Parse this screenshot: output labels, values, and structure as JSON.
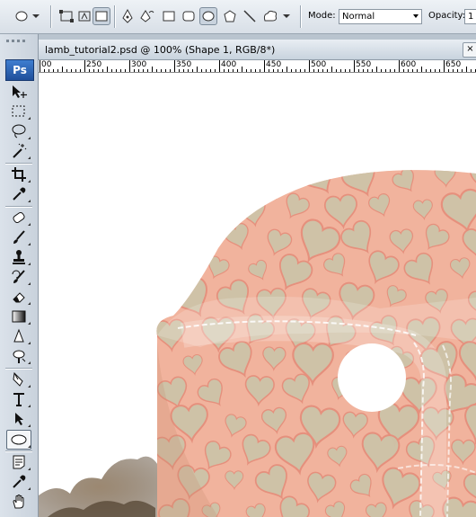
{
  "options": {
    "mode_label": "Mode:",
    "mode_value": "Normal",
    "opacity_label": "Opacity:",
    "opacity_value": "1"
  },
  "toolbox": {
    "logo": "Ps",
    "tools": [
      "move-icon",
      "marquee-icon",
      "lasso-icon",
      "magic-wand-icon",
      "crop-icon",
      "eyedropper-icon",
      "healing-brush-icon",
      "brush-icon",
      "clone-stamp-icon",
      "history-brush-icon",
      "eraser-icon",
      "gradient-icon",
      "blur-icon",
      "dodge-icon",
      "path-selection-icon",
      "type-icon",
      "direct-selection-icon",
      "ellipse-shape-icon",
      "notes-icon",
      "eyedropper2-icon",
      "hand-icon"
    ]
  },
  "document": {
    "title": "lamb_tutorial2.psd @ 100% (Shape 1, RGB/8*)",
    "close_glyph": "×"
  },
  "ruler": {
    "labels": [
      "00",
      "250",
      "300",
      "350",
      "400",
      "450",
      "500",
      "550",
      "600",
      "650"
    ]
  },
  "colors": {
    "shape_fill": "#f4b9a3",
    "heart_fill": "#cdc3a8",
    "wool": "#6f5a43"
  }
}
